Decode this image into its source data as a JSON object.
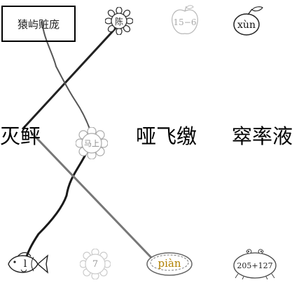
{
  "top_word": "猿屿赃庞",
  "top_row": {
    "sunflower": "陈",
    "apple": "15−6",
    "plum": "xùn"
  },
  "middle_row": {
    "word_left": "灭鲆",
    "flower": "马上",
    "word_center": "哑飞缴",
    "word_right": "窣率液"
  },
  "bottom_row": {
    "fish": "l",
    "sun": "7",
    "pie": "piàn",
    "bug": "205+127"
  }
}
